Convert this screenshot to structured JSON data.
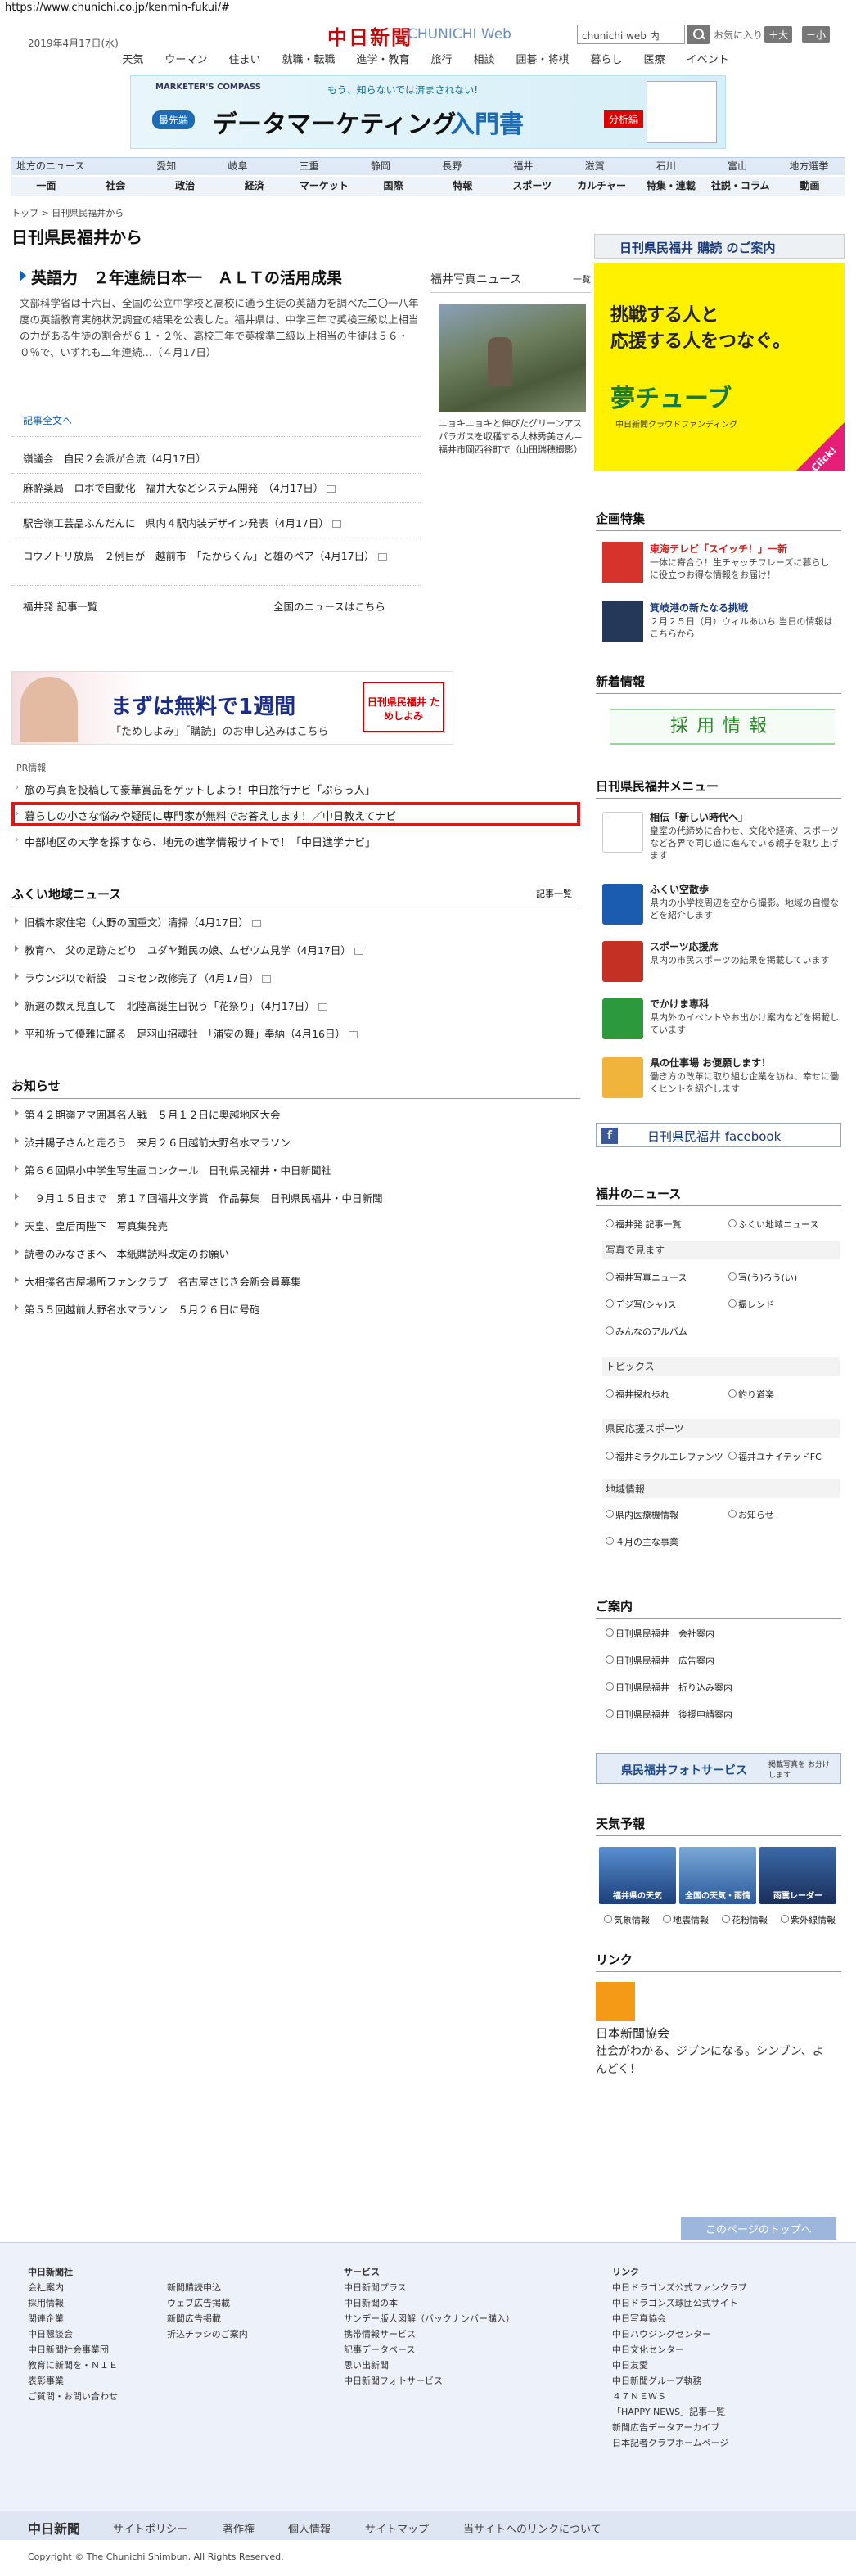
{
  "url": "https://www.chunichi.co.jp/kenmin-fukui/#",
  "header": {
    "date": "2019年4月17日(水)",
    "logo": "中日新聞",
    "logo_en": "CHUNICHI Web",
    "search_placeholder": "chunichi web 内",
    "fav": "お気に入り (0)",
    "font_up": "＋大",
    "font_down": "－小"
  },
  "topnav": [
    "天気",
    "ウーマン",
    "住まい",
    "就職・転職",
    "進学・教育",
    "旅行",
    "相談",
    "囲碁・将棋",
    "暮らし",
    "医療",
    "イベント"
  ],
  "ad1": {
    "brand": "MARKETER'S COMPASS",
    "tag": "もう、知らないでは済まされない!",
    "badge": "最先端",
    "title": "データマーケティング",
    "title2": "入門書",
    "badge2": "分析編"
  },
  "regions": [
    "地方のニュース",
    "愛知",
    "岐阜",
    "三重",
    "静岡",
    "長野",
    "福井",
    "滋賀",
    "石川",
    "富山",
    "地方選挙"
  ],
  "categories": [
    "一面",
    "社会",
    "政治",
    "経済",
    "マーケット",
    "国際",
    "特報",
    "スポーツ",
    "カルチャー",
    "特集・連載",
    "社説・コラム",
    "動画"
  ],
  "breadcrumb": "トップ > 日刊県民福井から",
  "page_title": "日刊県民福井から",
  "lead": {
    "headline": "英語力　２年連続日本一　ＡＬＴの活用成果",
    "body": "文部科学省は十六日、全国の公立中学校と高校に通う生徒の英語力を調べた二〇一八年度の英語教育実施状況調査の結果を公表した。福井県は、中学三年で英検三級以上相当の力がある生徒の割合が６１・２％、高校三年で英検準二級以上相当の生徒は５６・０％で、いずれも二年連続…（４月17日）",
    "more": "記事全文へ"
  },
  "articles": [
    "嶺議会　自民２会派が合流（4月17日）",
    "麻酔薬局　ロボで自動化　福井大などシステム開発　（4月17日）",
    "駅舎嶺工芸品ふんだんに　県内４駅内装デザイン発表（4月17日）",
    "コウノトリ放鳥　２例目が　越前市　「たからくん」と雄のペア（4月17日）"
  ],
  "links": {
    "fukui_list": "福井発 記事一覧",
    "national": "全国のニュースはこちら"
  },
  "photo": {
    "head": "福井写真ニュース",
    "more": "一覧",
    "caption": "ニョキニョキと伸びたグリーンアスパラガスを収穫する大林秀美さん＝福井市岡西谷町で（山田瑞穂撮影）"
  },
  "tameshiyomi": {
    "title": "まずは無料で1週間",
    "sub": "「ためしよみ」「購読」のお申し込みはこちら",
    "box": "日刊県民福井 ためしよみ"
  },
  "pr": {
    "label": "PR情報",
    "items": [
      "旅の写真を投稿して豪華賞品をゲットしよう！中日旅行ナビ「ぶらっ人」",
      "暮らしの小さな悩みや疑問に専門家が無料でお答えします！／中日教えてナビ",
      "中部地区の大学を探すなら、地元の進学情報サイトで！「中日進学ナビ」"
    ]
  },
  "local": {
    "title": "ふくい地域ニュース",
    "more": "記事一覧",
    "items": [
      "旧橋本家住宅（大野の国重文）清掃（4月17日）",
      "教育へ　父の足跡たどり　ユダヤ難民の娘、ムゼウム見学（4月17日）",
      "ラウンジ以で新設　コミセン改修完了（4月17日）",
      "新選の数え見直して　北陸高誕生日祝う「花祭り」（4月17日）",
      "平和祈って優雅に踊る　足羽山招魂社　「浦安の舞」奉納（4月16日）"
    ]
  },
  "notice": {
    "title": "お知らせ",
    "items": [
      "第４２期嶺アマ囲碁名人戦　５月１２日に奥越地区大会",
      "渋井陽子さんと走ろう　来月２６日越前大野名水マラソン",
      "第６６回県小中学生写生画コンクール　日刊県民福井・中日新聞社",
      "　９月１５日まで　第１７回福井文学賞　作品募集　日刊県民福井・中日新聞",
      "天皇、皇后両陛下　写真集発売",
      "読者のみなさまへ　本紙購読料改定のお願い",
      "大相撲名古屋場所ファンクラブ　名古屋さじき会新会員募集",
      "第５５回越前大野名水マラソン　５月２６日に号砲"
    ]
  },
  "side": {
    "subscribe": "日刊県民福井 購読 のご案内",
    "yume_copy1": "挑戦する人と",
    "yume_copy2": "応援する人をつなぐ。",
    "yume_logo": "夢チューブ",
    "yume_sub": "中日新聞クラウドファンディング",
    "yume_click": "Click!",
    "kikaku": "企画特集",
    "kikaku_items": [
      {
        "t": "東海テレビ「スイッチ！」一新",
        "d": "一体に寄合う！生チャッチフレーズに暮らしに役立つお得な情報をお届け！"
      },
      {
        "t": "箕岐港の新たなる挑戦",
        "d": "２月２５日（月）ウィルあいち 当日の情報はこちらから"
      }
    ],
    "shinsotsu": "新着情報",
    "recruit": "採用情報",
    "menu_title": "日刊県民福井メニュー",
    "menu": [
      {
        "t": "相伝「新しい時代へ」",
        "d": "皇室の代締めに合わせ、文化や経済、スポーツなど各界で同じ道に進んでいる親子を取り上げます"
      },
      {
        "t": "ふくい空散歩",
        "d": "県内の小学校周辺を空から撮影。地域の自慢などを紹介します"
      },
      {
        "t": "スポーツ応援席",
        "d": "県内の市民スポーツの結果を掲載しています"
      },
      {
        "t": "でかけま専科",
        "d": "県内外のイベントやお出かけ案内などを掲載しています"
      },
      {
        "t": "県の仕事場 お便願します！",
        "d": "働き方の改革に取り組む企業を訪ね、幸せに働くヒントを紹介します"
      }
    ],
    "facebook": "日刊県民福井 facebook",
    "fukui_news": "福井のニュース",
    "fn_items": [
      "福井発 記事一覧",
      "ふくい地域ニュース"
    ],
    "photo_sub": "写真で見ます",
    "ph_items": [
      "福井写真ニュース",
      "写(う)ろう(い)",
      "デジ写(シャ)ス",
      "撮レンド",
      "みんなのアルバム"
    ],
    "topics": "トピックス",
    "tp_items": [
      "福井探れ歩れ",
      "釣り道楽"
    ],
    "sports": "県民応援スポーツ",
    "sp_items": [
      "福井ミラクルエレファンツ",
      "福井ユナイテッドFC"
    ],
    "region_info": "地域情報",
    "ri_items": [
      "県内医療機情報",
      "お知らせ",
      "４月の主な事業"
    ],
    "annai": "ご案内",
    "an_items": [
      "日刊県民福井　会社案内",
      "日刊県民福井　広告案内",
      "日刊県民福井　折り込み案内",
      "日刊県民福井　後援申請案内"
    ],
    "photosvc": "県民福井フォトサービス",
    "photosvc_sub": "掲載写真を お分けします",
    "weather": "天気予報",
    "wboxes": [
      "福井県の天気",
      "全国の天気・雨情",
      "雨雲レーダー"
    ],
    "w_links": [
      "気象情報",
      "地震情報",
      "花粉情報",
      "紫外線情報"
    ],
    "link": "リンク",
    "jsf_t": "日本新聞協会",
    "jsf_d": "社会がわかる、ジブンになる。シンブン、よんどく！"
  },
  "totop": "このページのトップへ",
  "footer": {
    "c1_h": "中日新聞社",
    "c1": [
      "会社案内",
      "採用情報",
      "関連企業",
      "中日懇談会",
      "中日新聞社会事業団",
      "教育に新聞を・ＮＩＥ",
      "表彰事業",
      "ご質問・お問い合わせ"
    ],
    "c2": [
      "新聞購読申込",
      "ウェブ広告掲載",
      "新聞広告掲載",
      "折込チラシのご案内"
    ],
    "c3_h": "サービス",
    "c3": [
      "中日新聞プラス",
      "中日新聞の本",
      "サンデー版大図解（バックナンバー購入）",
      "携帯情報サービス",
      "記事データベース",
      "思い出新聞",
      "中日新聞フォトサービス"
    ],
    "c4_h": "リンク",
    "c4": [
      "中日ドラゴンズ公式ファンクラブ",
      "中日ドラゴンズ球団公式サイト",
      "中日写真協会",
      "中日ハウジングセンター",
      "中日文化センター",
      "中日友愛",
      "中日新聞グループ執務",
      "４７ＮＥＷＳ",
      "「HAPPY NEWS」記事一覧",
      "新聞広告データアーカイブ",
      "日本記者クラブホームページ"
    ]
  },
  "bottom": {
    "logo": "中日新聞",
    "links": [
      "サイトポリシー",
      "著作権",
      "個人情報",
      "サイトマップ",
      "当サイトへのリンクについて"
    ],
    "copy": "Copyright © The Chunichi Shimbun, All Rights Reserved."
  }
}
